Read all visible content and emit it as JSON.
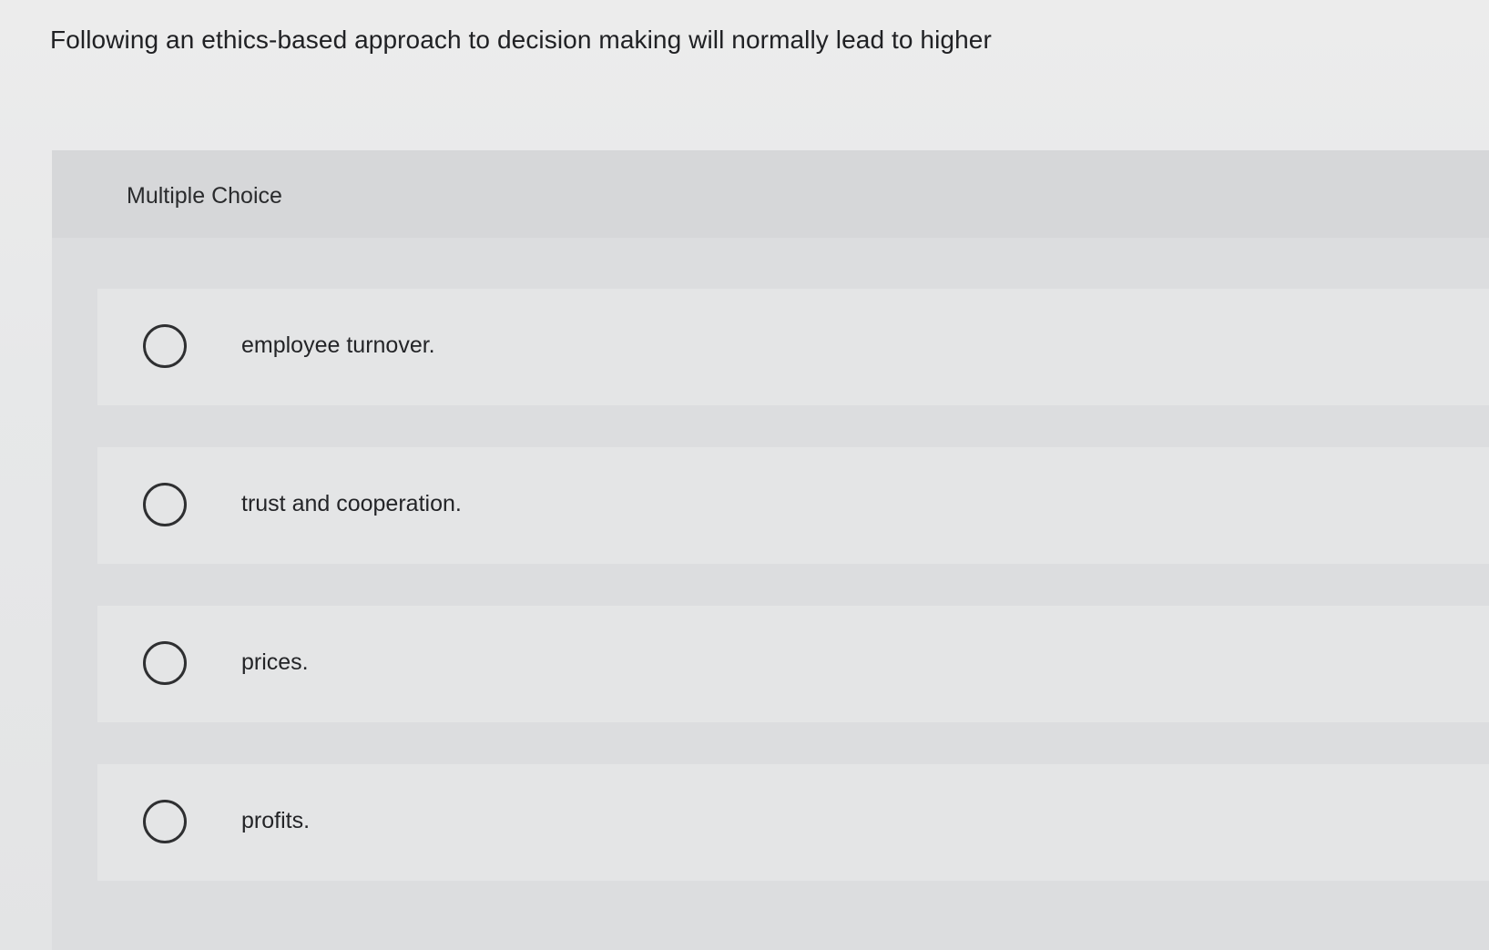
{
  "question": {
    "text": "Following an ethics-based approach to decision making will normally lead to higher"
  },
  "multiple_choice": {
    "title": "Multiple Choice",
    "options": [
      {
        "label": "employee turnover.",
        "selected": false
      },
      {
        "label": "trust and cooperation.",
        "selected": false
      },
      {
        "label": "prices.",
        "selected": false
      },
      {
        "label": "profits.",
        "selected": false
      }
    ]
  }
}
